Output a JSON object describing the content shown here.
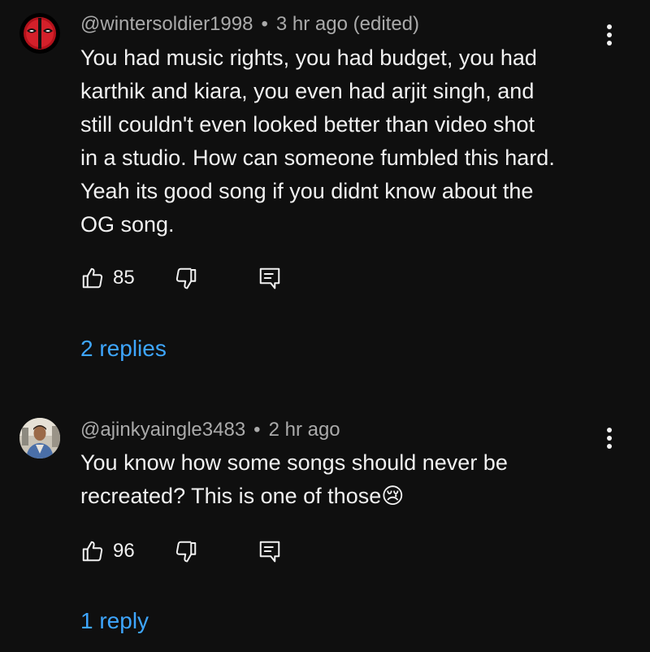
{
  "comments": [
    {
      "username": "@wintersoldier1998",
      "separator": "•",
      "timestamp": "3 hr ago (edited)",
      "text": "You had music rights, you had budget, you had\nkarthik and kiara, you even had arjit singh, and\nstill couldn't even looked better than video shot\nin a studio. How can someone fumbled this hard.\nYeah its good song if you didnt know about the\nOG song.",
      "likes": "85",
      "replies_label": "2 replies",
      "avatar_icon": "deadpool-avatar-icon"
    },
    {
      "username": "@ajinkyaingle3483",
      "separator": "•",
      "timestamp": "2 hr ago",
      "text": "You know how some songs should never be\nrecreated? This is one of those",
      "emoji": "😢",
      "likes": "96",
      "replies_label": "1 reply",
      "avatar_icon": "user-photo-avatar-icon"
    }
  ],
  "colors": {
    "background": "#0f0f0f",
    "text": "#f1f1f1",
    "meta": "#aaaaaa",
    "link": "#3ea6ff"
  }
}
